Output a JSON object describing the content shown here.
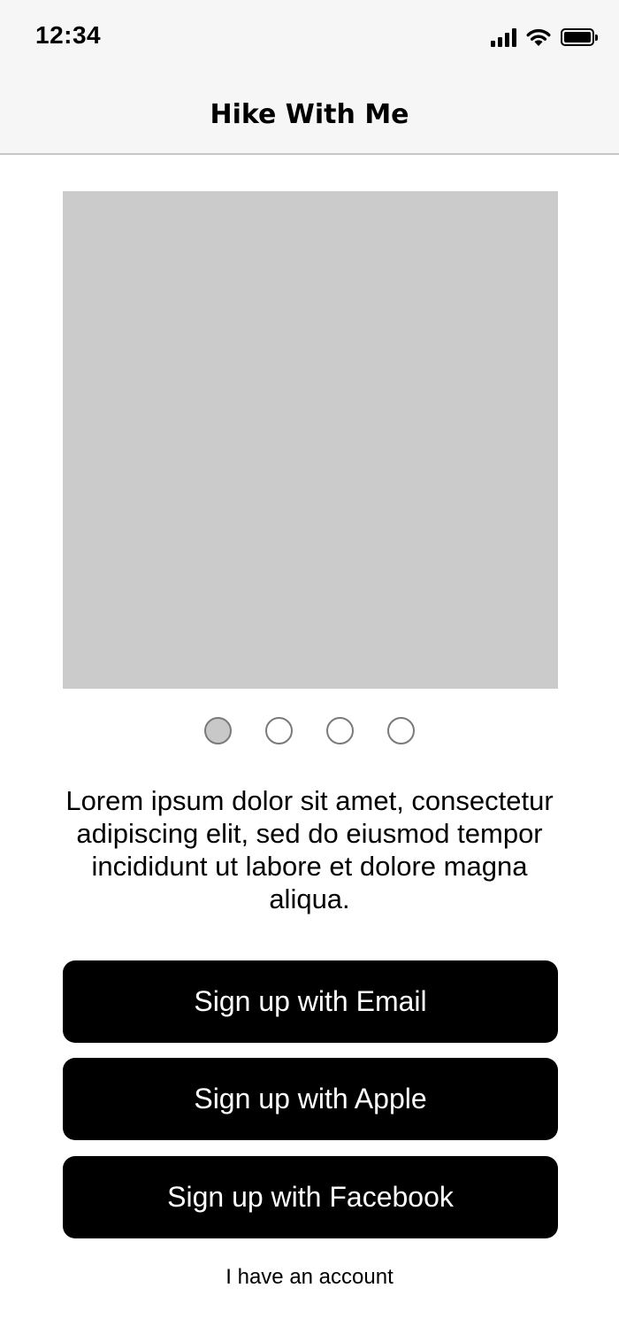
{
  "status_bar": {
    "time": "12:34",
    "signal_icon": "cellular-signal-icon",
    "wifi_icon": "wifi-icon",
    "battery_icon": "battery-full-icon"
  },
  "nav": {
    "title": "Hike With Me"
  },
  "carousel": {
    "image_placeholder_color": "#cbcbcb",
    "page_count": 4,
    "active_page": 1
  },
  "description": "Lorem ipsum dolor sit amet, consectetur adipiscing elit, sed do eiusmod tempor incididunt ut labore et dolore magna aliqua.",
  "buttons": {
    "email": "Sign up with Email",
    "apple": "Sign up with Apple",
    "facebook": "Sign up with Facebook"
  },
  "account_link": "I have an account",
  "colors": {
    "button_bg": "#000000",
    "button_text": "#ffffff",
    "header_bg": "#f6f6f6"
  }
}
